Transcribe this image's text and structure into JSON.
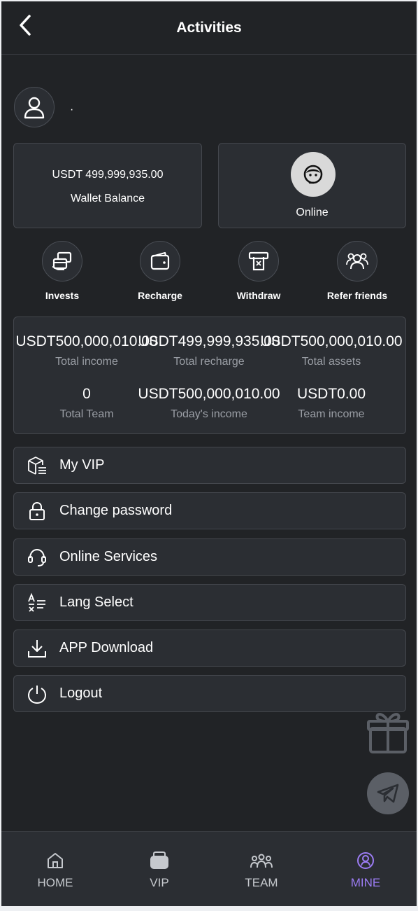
{
  "header": {
    "title": "Activities"
  },
  "profile": {
    "username": "·"
  },
  "wallet": {
    "amount": "USDT 499,999,935.00",
    "label": "Wallet Balance"
  },
  "online": {
    "label": "Online"
  },
  "quick_actions": [
    {
      "label": "Invests",
      "icon": "invest-icon"
    },
    {
      "label": "Recharge",
      "icon": "wallet-icon"
    },
    {
      "label": "Withdraw",
      "icon": "atm-icon"
    },
    {
      "label": "Refer friends",
      "icon": "friends-icon"
    }
  ],
  "stats": [
    {
      "value": "USDT500,000,010.00",
      "label": "Total income"
    },
    {
      "value": "USDT499,999,935.00",
      "label": "Total recharge"
    },
    {
      "value": "USDT500,000,010.00",
      "label": "Total assets"
    },
    {
      "value": "0",
      "label": "Total Team"
    },
    {
      "value": "USDT500,000,010.00",
      "label": "Today's income"
    },
    {
      "value": "USDT0.00",
      "label": "Team income"
    }
  ],
  "menu": [
    {
      "label": "My VIP",
      "icon": "vip-box-icon"
    },
    {
      "label": "Change password",
      "icon": "lock-icon"
    },
    {
      "label": "Online Services",
      "icon": "headset-icon"
    },
    {
      "label": "Lang Select",
      "icon": "language-icon"
    },
    {
      "label": "APP Download",
      "icon": "download-icon"
    },
    {
      "label": "Logout",
      "icon": "power-icon"
    }
  ],
  "tabs": [
    {
      "label": "HOME",
      "icon": "home-icon",
      "active": false
    },
    {
      "label": "VIP",
      "icon": "vip-icon",
      "active": false
    },
    {
      "label": "TEAM",
      "icon": "team-icon",
      "active": false
    },
    {
      "label": "MINE",
      "icon": "mine-icon",
      "active": true
    }
  ],
  "colors": {
    "background": "#212326",
    "card": "#2b2e33",
    "accent": "#9c7cf4",
    "muted_text": "#9a9ea5"
  }
}
